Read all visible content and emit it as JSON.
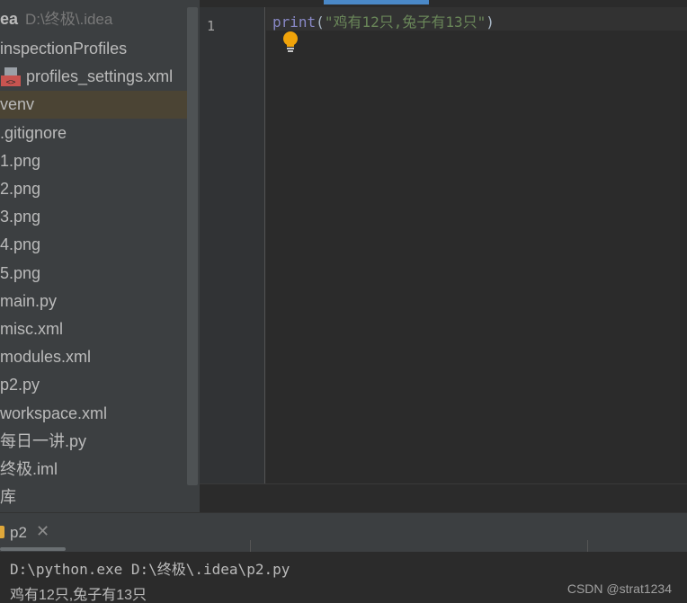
{
  "project_tree": {
    "root": {
      "name": "ea",
      "path": "D:\\终极\\.idea"
    },
    "items": [
      {
        "label": "inspectionProfiles"
      },
      {
        "label": "profiles_settings.xml",
        "icon": "xml-file-icon"
      },
      {
        "label": "venv",
        "selected": true
      },
      {
        "label": ".gitignore"
      },
      {
        "label": "1.png"
      },
      {
        "label": "2.png"
      },
      {
        "label": "3.png"
      },
      {
        "label": "4.png"
      },
      {
        "label": "5.png"
      },
      {
        "label": "main.py"
      },
      {
        "label": "misc.xml"
      },
      {
        "label": "modules.xml"
      },
      {
        "label": "p2.py"
      },
      {
        "label": "workspace.xml"
      },
      {
        "label": "每日一讲.py"
      },
      {
        "label": "终极.iml"
      },
      {
        "label": "库"
      }
    ]
  },
  "editor": {
    "line_number": "1",
    "code": {
      "keyword": "print",
      "open": "(",
      "string": "\"鸡有12只,兔子有13只\"",
      "close": ")"
    },
    "intention_icon": "lightbulb-icon"
  },
  "run": {
    "tab_label": "p2",
    "close_glyph": "✕",
    "command": "D:\\python.exe D:\\终极\\.idea\\p2.py",
    "output": "鸡有12只,兔子有13只"
  },
  "watermark": "CSDN @strat1234",
  "colors": {
    "panel_bg": "#3c3f41",
    "editor_bg": "#2b2b2b",
    "selection": "#4b4434",
    "keyword": "#8888c6",
    "string": "#6a8759",
    "accent": "#4a88c7",
    "bulb": "#f0a30a"
  }
}
